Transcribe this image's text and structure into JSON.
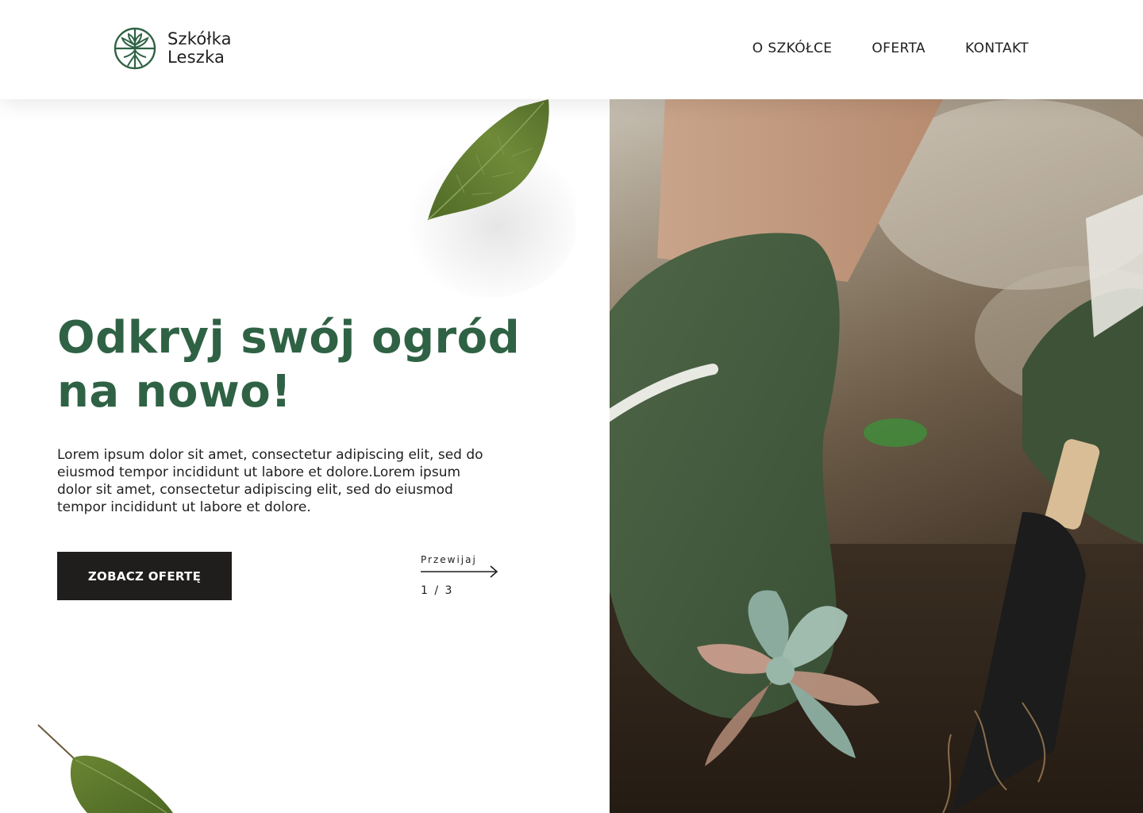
{
  "brand": {
    "name_line1": "Szkółka",
    "name_line2": "Leszka",
    "color": "#2f6244"
  },
  "nav": {
    "items": [
      {
        "label": "O SZKÓŁCE"
      },
      {
        "label": "OFERTA"
      },
      {
        "label": "KONTAKT"
      }
    ]
  },
  "hero": {
    "headline_line1": "Odkryj swój ogród",
    "headline_line2": "na nowo!",
    "lead": "Lorem ipsum dolor sit amet, consectetur adipiscing elit, sed do eiusmod tempor incididunt ut labore et dolore.Lorem ipsum dolor sit amet, consectetur adipiscing elit, sed do eiusmod tempor incididunt ut labore et dolore.",
    "cta_label": "ZOBACZ OFERTĘ",
    "slider": {
      "label": "Przewijaj",
      "counter": "1 / 3",
      "arrow_icon": "arrow-right-icon"
    },
    "photo_subject": "gloved-hand-planting-succulent",
    "icons": [
      "tree-logo-icon",
      "leaf-icon",
      "arrow-right-icon"
    ]
  },
  "colors": {
    "accent": "#2f6244",
    "button_bg": "#201e1c",
    "text": "#1f1f1f",
    "background": "#ffffff"
  }
}
